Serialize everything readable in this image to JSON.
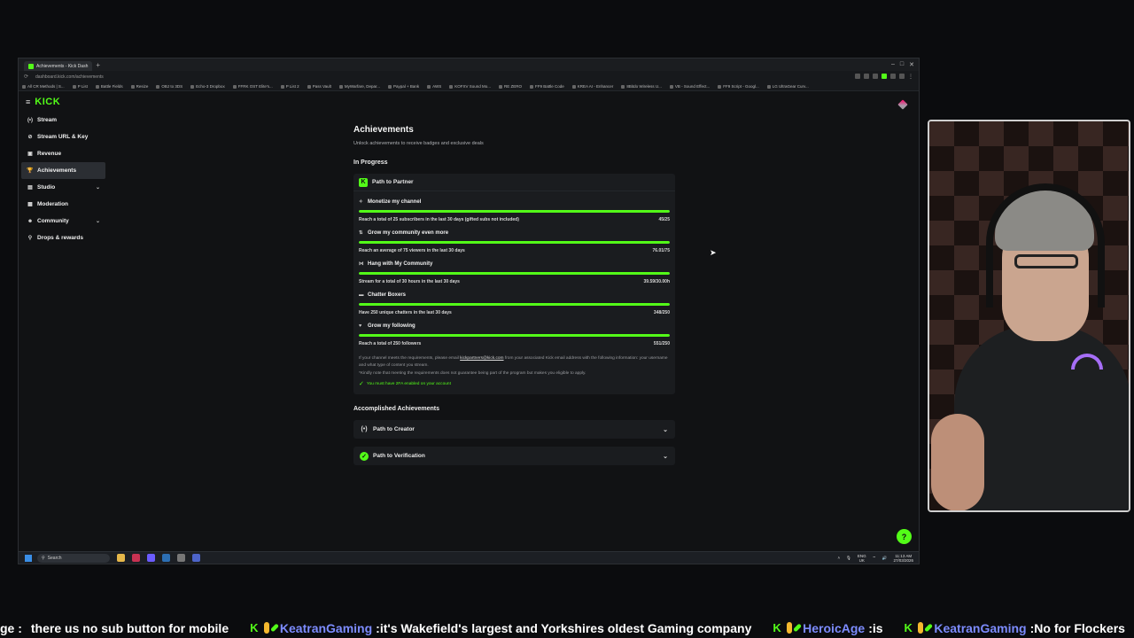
{
  "browser": {
    "tab_title": "Achievements - Kick Dash",
    "url": "dashboard.kick.com/achievements",
    "bookmarks": [
      "All CR Methods | S...",
      "P List",
      "Battle Fields",
      "Resize",
      "OBJ to 3DS",
      "Echo-3 Dropbox",
      "FFRK OST Elite's...",
      "P List 2",
      "Pass Vault",
      "MyWarfare, Depar...",
      "Paypal + Bank",
      "AWS",
      "KOFXV Sound Mo...",
      "RE ZERO",
      "FF9 Battle Code",
      "KREA AI - Enhancer",
      "8Bitdo Wireless U...",
      "VB - Sound Effect...",
      "FF9 Script - Googl...",
      "LG UltraGear Curv..."
    ]
  },
  "sidebar": {
    "logo": "KICK",
    "items": [
      {
        "label": "Stream",
        "icon": "(•)"
      },
      {
        "label": "Stream URL & Key",
        "icon": "⊘"
      },
      {
        "label": "Revenue",
        "icon": "▣"
      },
      {
        "label": "Achievements",
        "icon": "🏆"
      },
      {
        "label": "Studio",
        "icon": "▤",
        "chev": "⌄"
      },
      {
        "label": "Moderation",
        "icon": "▦"
      },
      {
        "label": "Community",
        "icon": "☻",
        "chev": "⌄"
      },
      {
        "label": "Drops & rewards",
        "icon": "⚲"
      }
    ]
  },
  "main": {
    "title": "Achievements",
    "subtitle": "Unlock achievements to receive badges and exclusive deals",
    "in_progress_title": "In Progress",
    "partner_card": {
      "title": "Path to Partner",
      "goals": [
        {
          "title": "Monetize my channel",
          "desc": "Reach a total of 25 subscribers in the last 30 days (gifted subs not included)",
          "progress": "45/25",
          "fill": 1.0,
          "icon": "✧"
        },
        {
          "title": "Grow my community even more",
          "desc": "Reach an average of 75 viewers in the last 30 days",
          "progress": "76.01/75",
          "fill": 1.0,
          "icon": "⇅"
        },
        {
          "title": "Hang with My Community",
          "desc": "Stream for a total of 30 hours in the last 30 days",
          "progress": "39.59/30.00h",
          "fill": 1.0,
          "icon": "⋈"
        },
        {
          "title": "Chatter Boxers",
          "desc": "Have 250 unique chatters in the last 30 days",
          "progress": "348/250",
          "fill": 1.0,
          "icon": "▬"
        },
        {
          "title": "Grow my following",
          "desc": "Reach a total of 250 followers",
          "progress": "551/250",
          "fill": 1.0,
          "icon": "♥"
        }
      ],
      "info_pre": "If your channel meets the requirements, please email",
      "info_link": "kickpartners@kick.com",
      "info_post": "from your associated Kick email address with the following information: your username and what type of content you stream.",
      "note": "*Kindly note that meeting the requirements does not guarantee being part of the program but makes you eligible to apply.",
      "requirement": "You must have 2FA enabled on your account"
    },
    "accomplished_title": "Accomplished Achievements",
    "accomplished": [
      {
        "title": "Path to Creator",
        "icon": "(•)"
      },
      {
        "title": "Path to Verification",
        "icon": "✓"
      }
    ]
  },
  "taskbar": {
    "search": "Search",
    "lang_top": "ENG",
    "lang_bottom": "UK",
    "time": "11:13 AM",
    "date": "27/03/2026"
  },
  "ticker": {
    "messages": [
      {
        "user": "",
        "text": "there us no sub button for mobile"
      },
      {
        "user": "KeatranGaming",
        "text": "it's Wakefield's largest and Yorkshires oldest Gaming company"
      },
      {
        "user": "HeroicAge",
        "text": "is"
      },
      {
        "user": "KeatranGaming",
        "text": "No for Flockers"
      }
    ],
    "lead": "ge :"
  },
  "colors": {
    "accent": "#53fc18",
    "background": "#111214",
    "card": "#1a1c1f"
  }
}
